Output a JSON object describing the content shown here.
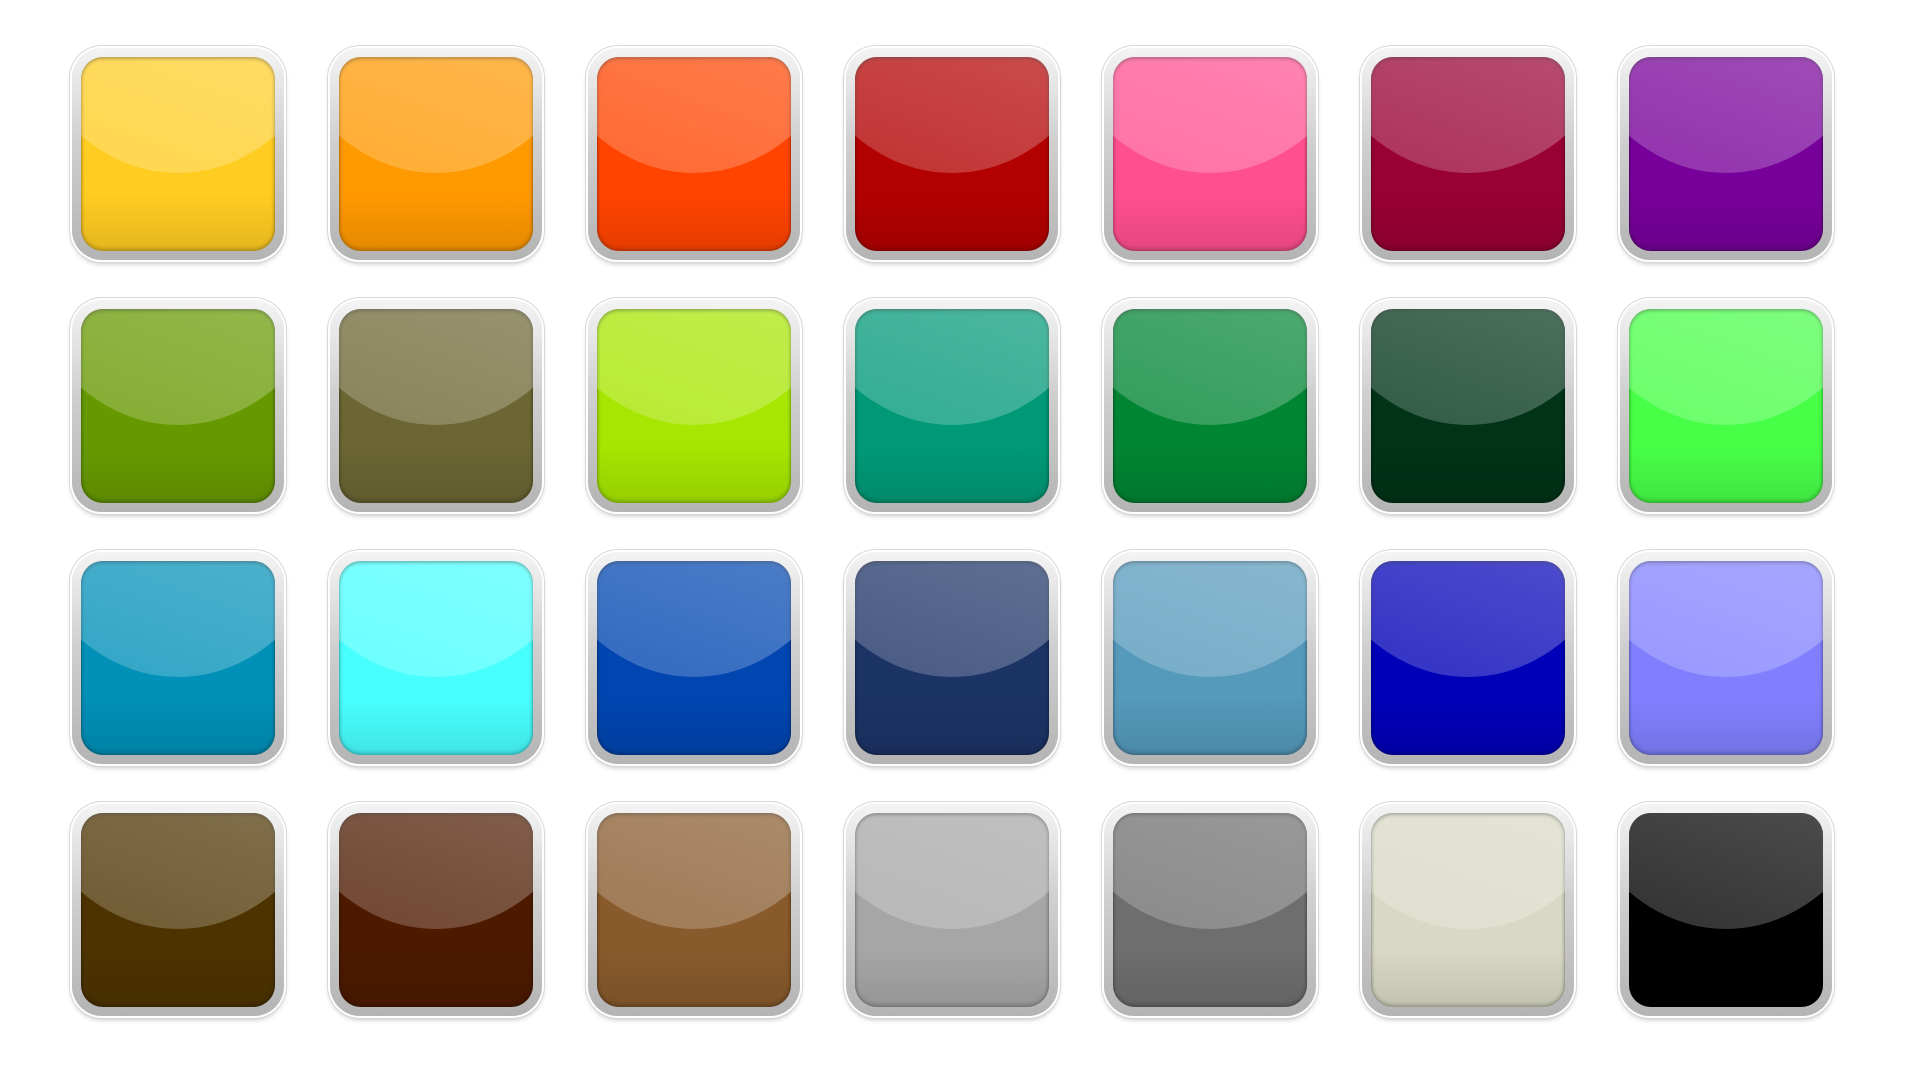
{
  "buttons": [
    {
      "name": "yellow",
      "color": "#ffcc22"
    },
    {
      "name": "orange",
      "color": "#ff9900"
    },
    {
      "name": "red-orange",
      "color": "#ff4400"
    },
    {
      "name": "dark-red",
      "color": "#b30000"
    },
    {
      "name": "pink",
      "color": "#ff4f8f"
    },
    {
      "name": "crimson",
      "color": "#990033"
    },
    {
      "name": "purple",
      "color": "#77009a"
    },
    {
      "name": "olive-green",
      "color": "#669900"
    },
    {
      "name": "khaki-olive",
      "color": "#6b6633"
    },
    {
      "name": "lime",
      "color": "#a6e600"
    },
    {
      "name": "teal",
      "color": "#009977"
    },
    {
      "name": "green",
      "color": "#008533"
    },
    {
      "name": "dark-green",
      "color": "#003318"
    },
    {
      "name": "bright-green",
      "color": "#47ff47"
    },
    {
      "name": "cerulean",
      "color": "#0090b8"
    },
    {
      "name": "cyan",
      "color": "#48ffff"
    },
    {
      "name": "blue",
      "color": "#0045b0"
    },
    {
      "name": "navy",
      "color": "#1c3366"
    },
    {
      "name": "steel-blue",
      "color": "#5599bb"
    },
    {
      "name": "royal-blue",
      "color": "#0000b8"
    },
    {
      "name": "periwinkle",
      "color": "#8080ff"
    },
    {
      "name": "dark-brown",
      "color": "#4d3300"
    },
    {
      "name": "maroon-brown",
      "color": "#4d1a00"
    },
    {
      "name": "brown",
      "color": "#885a2c"
    },
    {
      "name": "light-gray",
      "color": "#a6a6a6"
    },
    {
      "name": "gray",
      "color": "#6e6e6e"
    },
    {
      "name": "beige",
      "color": "#d8d8c4"
    },
    {
      "name": "black",
      "color": "#000000"
    }
  ]
}
